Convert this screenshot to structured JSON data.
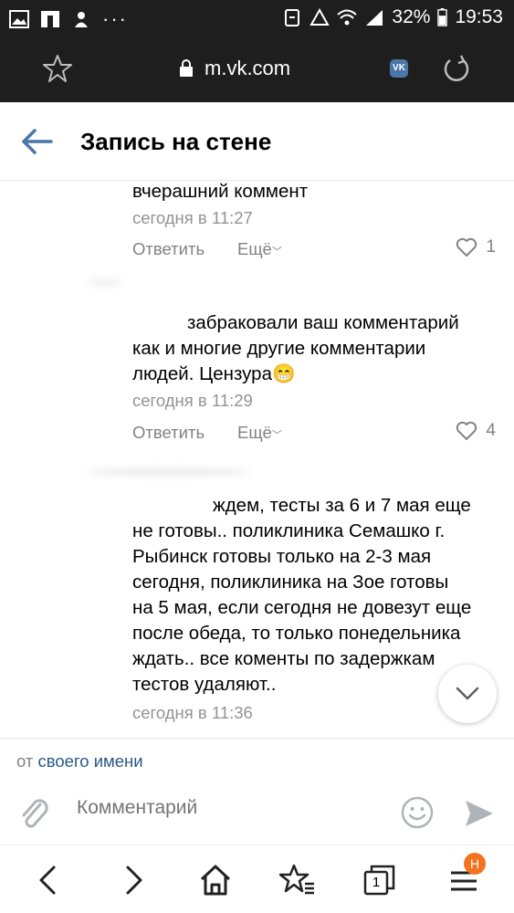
{
  "status_bar": {
    "battery": "32%",
    "time": "19:53"
  },
  "browser": {
    "url": "m.vk.com",
    "site_badge": "VK"
  },
  "header": {
    "title": "Запись на стене"
  },
  "comments": [
    {
      "text_lines": [
        "вчерашний коммент"
      ],
      "time": "сегодня в 11:27",
      "reply_label": "Ответить",
      "more_label": "Ещё",
      "likes": "1"
    },
    {
      "text_lines": [
        "забраковали ваш комментарий",
        "как и многие другие комментарии",
        "людей. Цензура😁"
      ],
      "time": "сегодня в 11:29",
      "reply_label": "Ответить",
      "more_label": "Ещё",
      "likes": "4"
    },
    {
      "text_lines": [
        "ждем, тесты за 6 и 7 мая еще",
        "не готовы.. поликлиника Семашко г.",
        "Рыбинск готовы только на 2-3 мая",
        "сегодня, поликлиника на Зое готовы",
        "на 5 мая, если сегодня не довезут еще",
        "после обеда, то только понедельника",
        "ждать.. все коменты по задержкам",
        "тестов удаляют.."
      ],
      "time": "сегодня в 11:36"
    }
  ],
  "composer": {
    "from_prefix": "от",
    "from_link": "своего имени",
    "placeholder": "Комментарий"
  },
  "bottom_nav": {
    "tabs_count": "1",
    "menu_badge": "H"
  }
}
